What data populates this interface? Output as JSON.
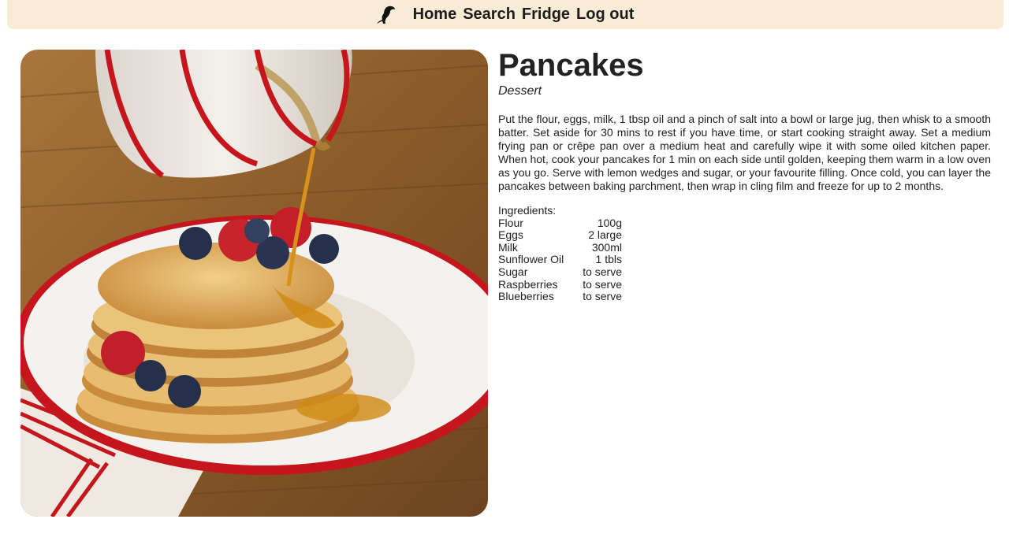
{
  "nav": {
    "logo_icon": "logo-icon",
    "links": [
      "Home",
      "Search",
      "Fridge",
      "Log out"
    ]
  },
  "recipe": {
    "title": "Pancakes",
    "category": "Dessert",
    "method": "Put the flour, eggs, milk, 1 tbsp oil and a pinch of salt into a bowl or large jug, then whisk to a smooth batter. Set aside for 30 mins to rest if you have time, or start cooking straight away. Set a medium frying pan or crêpe pan over a medium heat and carefully wipe it with some oiled kitchen paper. When hot, cook your pancakes for 1 min on each side until golden, keeping them warm in a low oven as you go. Serve with lemon wedges and sugar, or your favourite filling. Once cold, you can layer the pancakes between baking parchment, then wrap in cling film and freeze for up to 2 months.",
    "ingredients_label": "Ingredients:",
    "ingredients": [
      {
        "name": "Flour",
        "qty": "100g"
      },
      {
        "name": "Eggs",
        "qty": "2 large"
      },
      {
        "name": "Milk",
        "qty": "300ml"
      },
      {
        "name": "Sunflower Oil",
        "qty": "1 tbls"
      },
      {
        "name": "Sugar",
        "qty": "to serve"
      },
      {
        "name": "Raspberries",
        "qty": "to serve"
      },
      {
        "name": "Blueberries",
        "qty": "to serve"
      }
    ]
  },
  "colors": {
    "nav_background": "#f8ecd6",
    "plate_rim": "#c4161c",
    "text": "#1f1f1f"
  }
}
